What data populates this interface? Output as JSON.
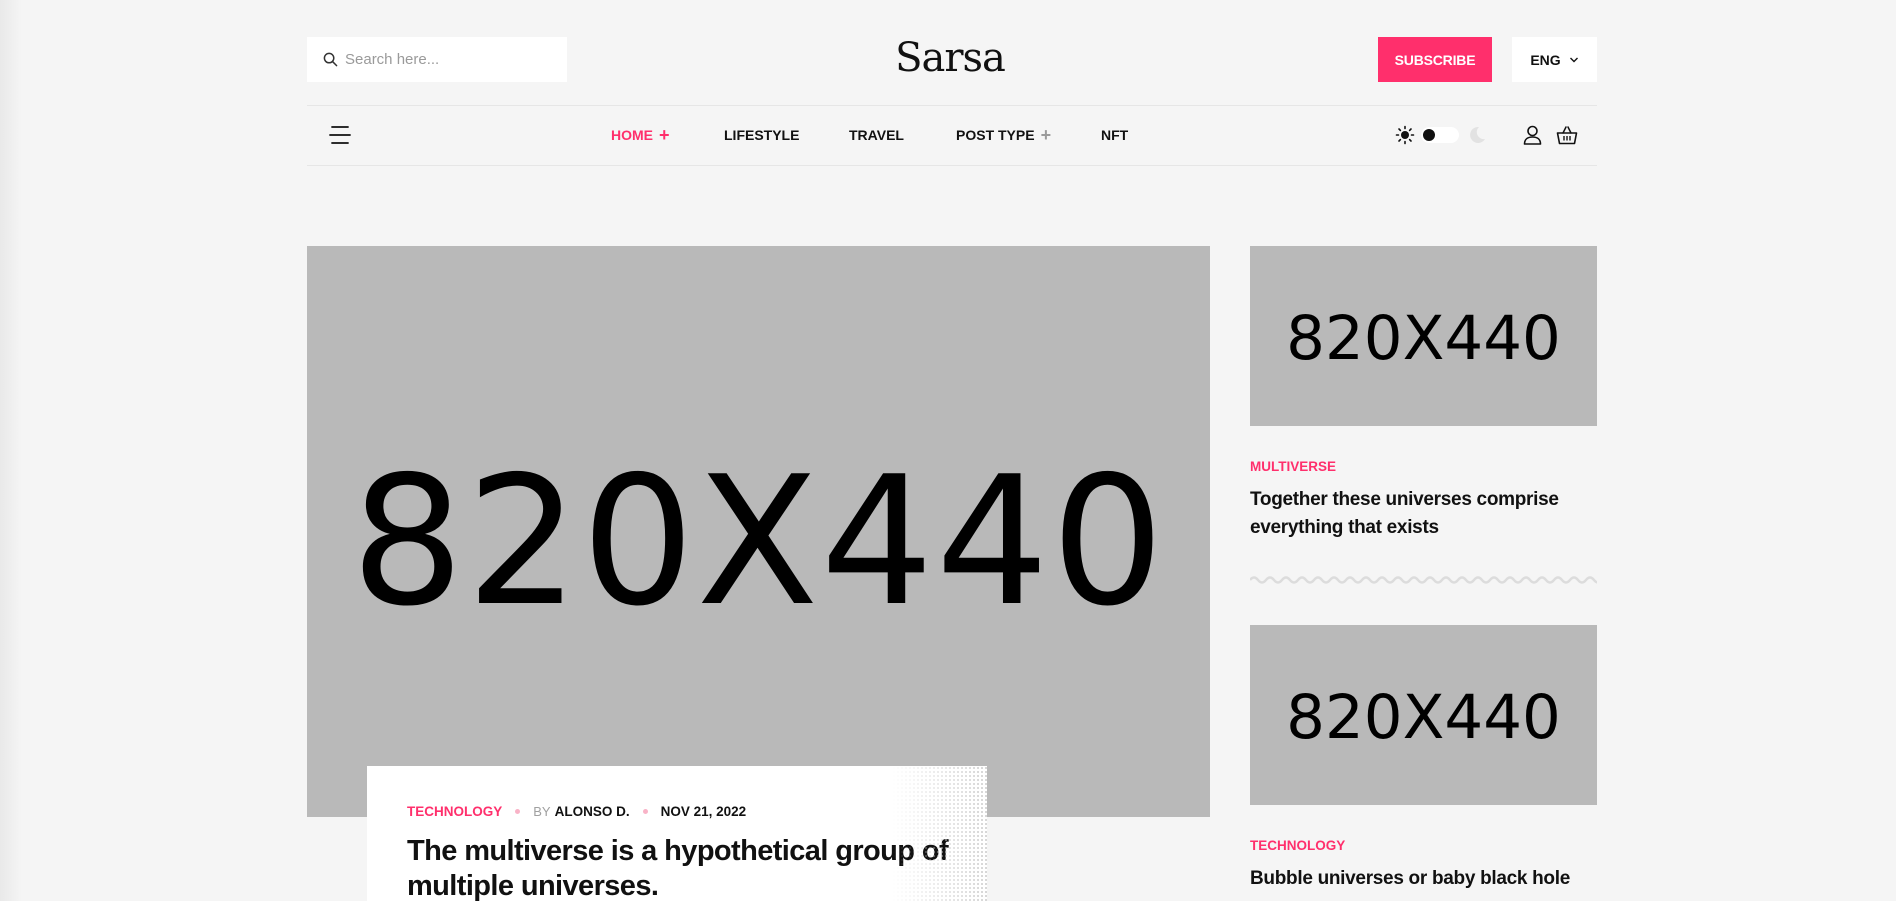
{
  "header": {
    "search_placeholder": "Search here...",
    "logo_text": "Sarsa",
    "subscribe_label": "SUBSCRIBE",
    "language": "ENG"
  },
  "nav": {
    "items": [
      {
        "label": "HOME",
        "active": true,
        "has_submenu": true
      },
      {
        "label": "LIFESTYLE",
        "active": false,
        "has_submenu": false
      },
      {
        "label": "TRAVEL",
        "active": false,
        "has_submenu": false
      },
      {
        "label": "POST TYPE",
        "active": false,
        "has_submenu": true
      },
      {
        "label": "NFT",
        "active": false,
        "has_submenu": false
      }
    ],
    "plus_symbol": "+"
  },
  "feature": {
    "image_text": "820X440",
    "category": "TECHNOLOGY",
    "by_label": "BY",
    "author": "ALONSO D.",
    "date": "NOV 21, 2022",
    "title": "The multiverse is a hypothetical group of multiple universes."
  },
  "sidebar": {
    "posts": [
      {
        "image_text": "820X440",
        "category": "MULTIVERSE",
        "title": "Together these universes comprise everything that exists"
      },
      {
        "image_text": "820X440",
        "category": "TECHNOLOGY",
        "title": "Bubble universes or baby black hole"
      }
    ]
  },
  "colors": {
    "accent": "#ff2f6c",
    "background": "#f5f5f5",
    "placeholder_image": "#b9b9b9"
  },
  "icons": [
    "search-icon",
    "chevron-down-icon",
    "hamburger-menu-icon",
    "sun-icon",
    "moon-icon",
    "user-icon",
    "shopping-basket-icon"
  ]
}
